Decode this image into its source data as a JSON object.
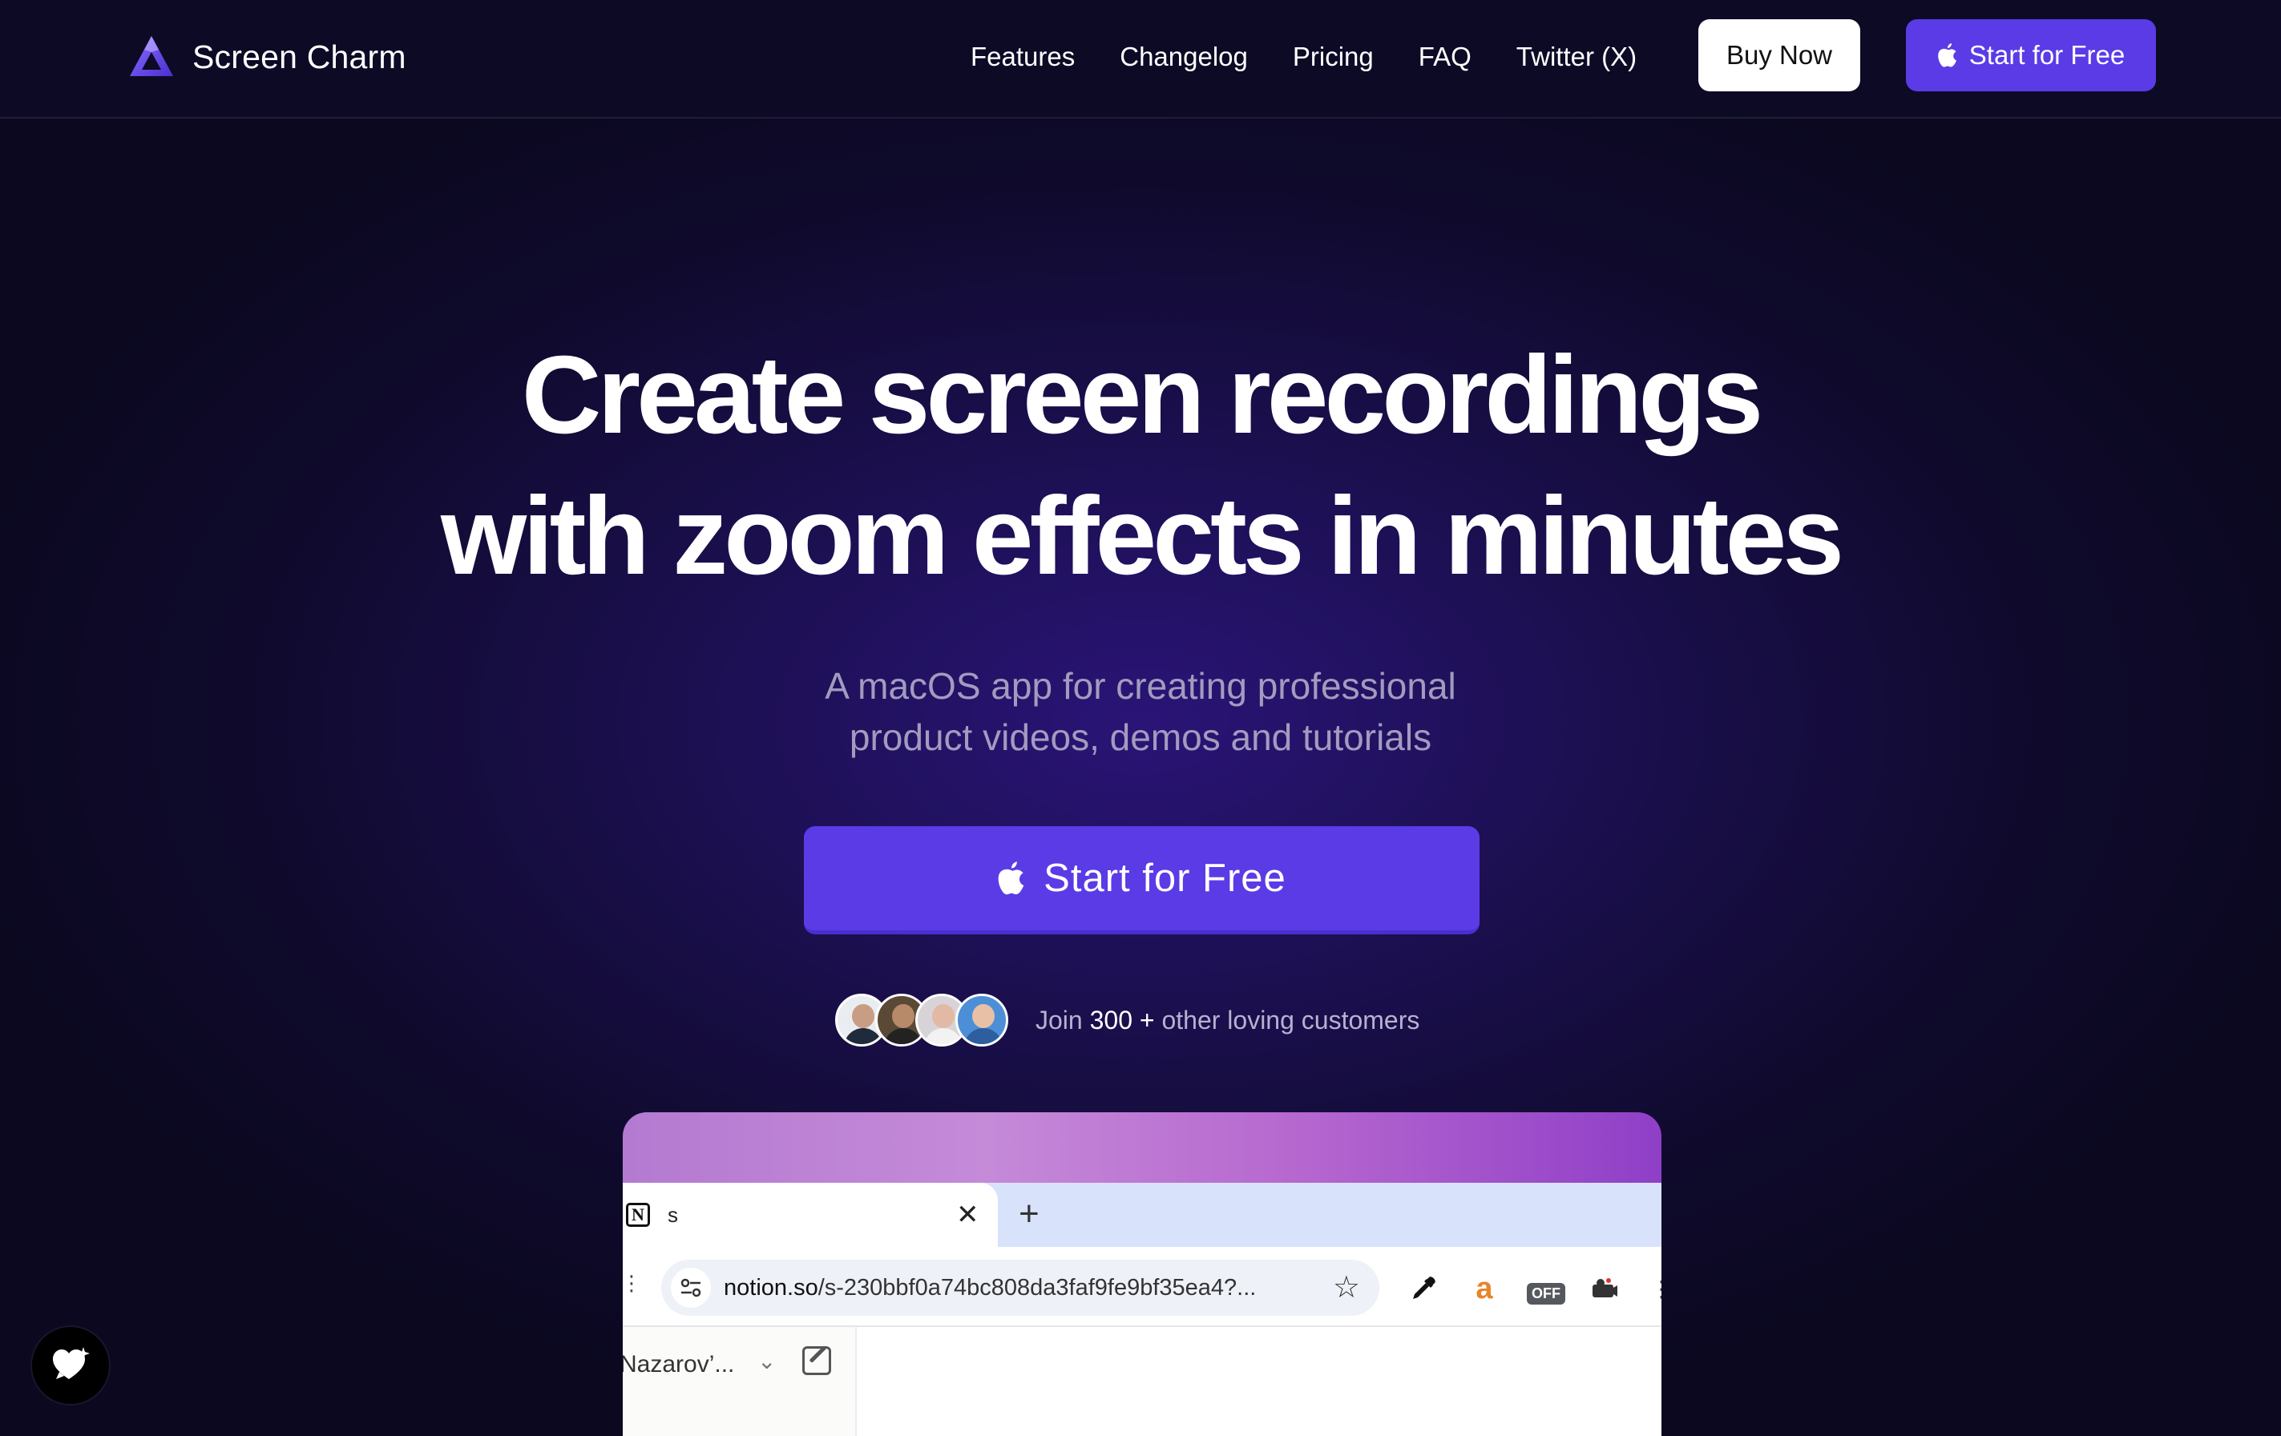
{
  "brand": {
    "name": "Screen Charm",
    "logo_icon": "triangle-logo-icon"
  },
  "nav": {
    "links": [
      "Features",
      "Changelog",
      "Pricing",
      "FAQ",
      "Twitter (X)"
    ],
    "buy_label": "Buy Now",
    "start_label": "Start for Free"
  },
  "hero": {
    "title_line1": "Create screen recordings",
    "title_line2": "with zoom effects in minutes",
    "subtitle_line1": "A macOS app for creating professional",
    "subtitle_line2": "product videos, demos and tutorials",
    "cta_label": "Start for Free"
  },
  "social": {
    "prefix": "Join ",
    "count": "300 +",
    "suffix": " other loving customers"
  },
  "preview": {
    "tab_title": "s",
    "tab_icon_letter": "N",
    "url_domain": "notion.so",
    "url_path": "/s-230bbf0a74bc808da3faf9fe9bf35ea4?...",
    "ext_off_badge": "OFF",
    "ext_amazon_letter": "a",
    "workspace_name": "Nazarov’..."
  },
  "colors": {
    "accent": "#5b3be6",
    "background": "#0b0820",
    "subtitle": "#a39bbf"
  }
}
